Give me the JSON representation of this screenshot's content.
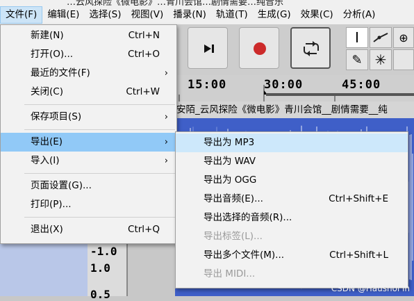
{
  "window_title_fragment": "…云风探险《微电影》…青川会馆…剧情需要…纯音乐",
  "menubar": [
    "文件(F)",
    "编辑(E)",
    "选择(S)",
    "视图(V)",
    "播录(N)",
    "轨道(T)",
    "生成(G)",
    "效果(C)",
    "分析(A)"
  ],
  "file_menu": {
    "new": {
      "label": "新建(N)",
      "shortcut": "Ctrl+N"
    },
    "open": {
      "label": "打开(O)...",
      "shortcut": "Ctrl+O"
    },
    "recent": {
      "label": "最近的文件(F)",
      "arrow": "›"
    },
    "close": {
      "label": "关闭(C)",
      "shortcut": "Ctrl+W"
    },
    "save_project": {
      "label": "保存项目(S)",
      "arrow": "›"
    },
    "export": {
      "label": "导出(E)",
      "arrow": "›"
    },
    "import": {
      "label": "导入(I)",
      "arrow": "›"
    },
    "page_setup": {
      "label": "页面设置(G)..."
    },
    "print": {
      "label": "打印(P)..."
    },
    "exit": {
      "label": "退出(X)",
      "shortcut": "Ctrl+Q"
    }
  },
  "export_menu": {
    "mp3": {
      "label": "导出为 MP3"
    },
    "wav": {
      "label": "导出为 WAV"
    },
    "ogg": {
      "label": "导出为 OGG"
    },
    "audio": {
      "label": "导出音频(E)...",
      "shortcut": "Ctrl+Shift+E"
    },
    "selected": {
      "label": "导出选择的音频(R)..."
    },
    "labels": {
      "label": "导出标签(L)..."
    },
    "multiple": {
      "label": "导出多个文件(M)...",
      "shortcut": "Ctrl+Shift+L"
    },
    "midi": {
      "label": "导出 MIDI..."
    }
  },
  "timeline": {
    "ticks": [
      "15:00",
      "30:00",
      "45:00"
    ]
  },
  "track": {
    "name": "安陌_云风探险《微电影》青川会馆__剧情需要__纯"
  },
  "track_scale": [
    "-1.0",
    "1.0",
    "0.5"
  ],
  "watermark": "CSDN @Haushol in",
  "colors": {
    "menu_highlight": "#91c9f7",
    "waveform": "#3f5fc8",
    "record": "#cc2a2a"
  }
}
